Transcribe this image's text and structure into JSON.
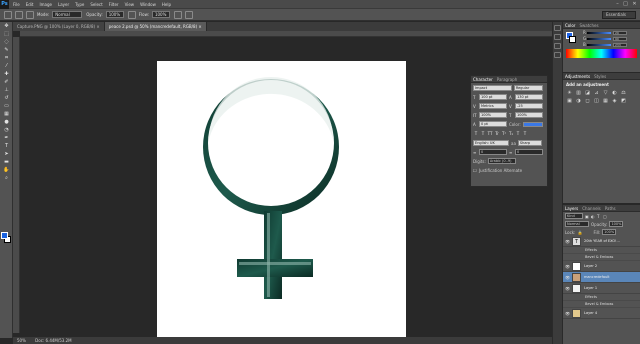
{
  "app": {
    "logo": "Ps"
  },
  "menu": [
    "File",
    "Edit",
    "Image",
    "Layer",
    "Type",
    "Select",
    "Filter",
    "View",
    "Window",
    "Help"
  ],
  "window_controls": [
    "–",
    "□",
    "✕"
  ],
  "options": {
    "mode_label": "Mode:",
    "mode_value": "Normal",
    "opacity_label": "Opacity:",
    "opacity_value": "100%",
    "flow_label": "Flow:",
    "flow_value": "100%",
    "workspace": "Essentials"
  },
  "tabs": [
    {
      "label": "Capture.PNG @ 100% (Layer 0, RGB/8) ×"
    },
    {
      "label": "peace 2.psd @ 50% (mancredefault, RGB/8) ×"
    }
  ],
  "status": {
    "zoom": "50%",
    "doc": "Doc: 6.44M/53.2M"
  },
  "color_panel": {
    "tabs": [
      "Color",
      "Swatches"
    ],
    "rows": [
      {
        "label": "R",
        "value": "29"
      },
      {
        "label": "G",
        "value": "99"
      },
      {
        "label": "B",
        "value": "233"
      }
    ],
    "fg": "#1d63e9"
  },
  "adjustments": {
    "tabs": [
      "Adjustments",
      "Styles"
    ],
    "title": "Add an adjustment",
    "icons": [
      "☀",
      "▥",
      "◪",
      "⊿",
      "▽",
      "◐",
      "⚖",
      "▣",
      "◑",
      "◻",
      "◫",
      "▦",
      "◈",
      "◩"
    ]
  },
  "character": {
    "tabs": [
      "Character",
      "Paragraph"
    ],
    "font_family": "Impact",
    "font_style": "Regular",
    "font_size": "100 pt",
    "leading": "130 pt",
    "kerning": "Metrics",
    "tracking": "-25",
    "vscale": "100%",
    "hscale": "100%",
    "baseline": "0 pt",
    "color_label": "Color:",
    "color": "#3a78e6",
    "language": "English: UK",
    "aa_label": "aa",
    "aa": "Sharp",
    "hyph1": "0",
    "hyph2": "0",
    "digits_label": "Digits:",
    "digits": "Arabic (0..9)",
    "justification": "Justification Alternate",
    "format_buttons": [
      "T",
      "T",
      "TT",
      "Tr",
      "T¹",
      "T₁",
      "T",
      "T"
    ]
  },
  "layers": {
    "tabs": [
      "Layers",
      "Channels",
      "Paths"
    ],
    "kind": "Kind",
    "blend": "Normal",
    "opacity_label": "Opacity:",
    "opacity": "100%",
    "fill_label": "Fill:",
    "fill": "100%",
    "lock_label": "Lock:",
    "rows": [
      {
        "name": "20th YEAR of EXO!...",
        "type": "text",
        "sub": [
          "Effects",
          "Bevel & Emboss"
        ]
      },
      {
        "name": "Layer 2",
        "type": "layer",
        "sub": []
      },
      {
        "name": "mancredefault",
        "type": "image",
        "selected": true,
        "sub": []
      },
      {
        "name": "Layer 1",
        "type": "layer",
        "sub": [
          "Effects",
          "Bevel & Emboss"
        ]
      },
      {
        "name": "Layer 4",
        "type": "layer",
        "sub": []
      }
    ]
  }
}
